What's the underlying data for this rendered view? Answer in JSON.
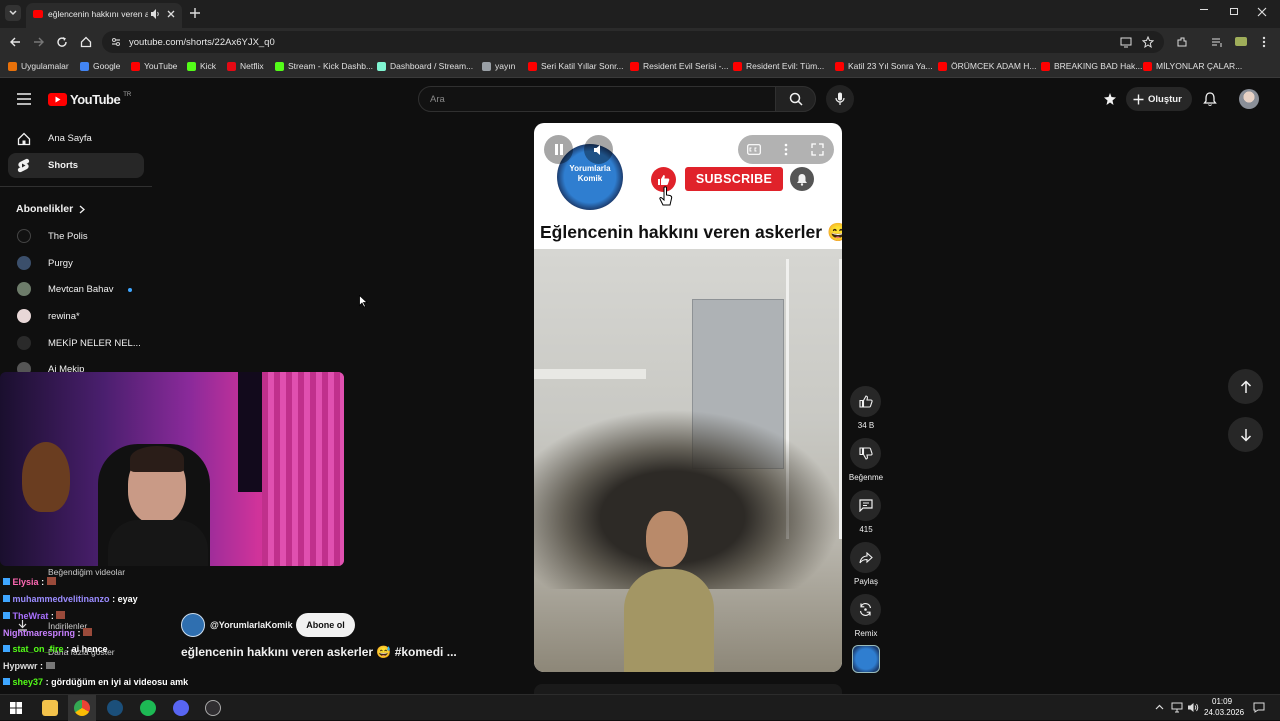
{
  "browser": {
    "tab_title": "eğlencenin hakkını veren askerler",
    "url": "youtube.com/shorts/22Ax6YJX_q0",
    "bookmarks": [
      {
        "label": "Uygulamalar",
        "icon": "apps-grid-icon",
        "color": "#e8710a"
      },
      {
        "label": "Google",
        "icon": "google-icon",
        "color": "#4285f4"
      },
      {
        "label": "YouTube",
        "icon": "youtube-icon",
        "color": "#ff0000"
      },
      {
        "label": "Kick",
        "icon": "kick-icon",
        "color": "#53fc18"
      },
      {
        "label": "Netflix",
        "icon": "netflix-icon",
        "color": "#e50914"
      },
      {
        "label": "Stream - Kick Dashb...",
        "icon": "kick-icon",
        "color": "#53fc18"
      },
      {
        "label": "Dashboard / Stream...",
        "icon": "streamlabs-icon",
        "color": "#80f5d2"
      },
      {
        "label": "yayın",
        "icon": "folder-icon",
        "color": "#9aa0a6"
      },
      {
        "label": "Seri Katil Yıllar Sonr...",
        "icon": "youtube-icon",
        "color": "#ff0000"
      },
      {
        "label": "Resident Evil Serisi -...",
        "icon": "youtube-icon",
        "color": "#ff0000"
      },
      {
        "label": "Resident Evil: Tüm...",
        "icon": "youtube-icon",
        "color": "#ff0000"
      },
      {
        "label": "Katil 23 Yıl Sonra Ya...",
        "icon": "youtube-icon",
        "color": "#ff0000"
      },
      {
        "label": "ÖRÜMCEK ADAM H...",
        "icon": "youtube-icon",
        "color": "#ff0000"
      },
      {
        "label": "BREAKING BAD Hak...",
        "icon": "youtube-icon",
        "color": "#ff0000"
      },
      {
        "label": "MİLYONLAR ÇALAR...",
        "icon": "youtube-icon",
        "color": "#ff0000"
      }
    ]
  },
  "youtube": {
    "logo_text": "YouTube",
    "logo_region": "TR",
    "search_placeholder": "Ara",
    "create_label": "Oluştur",
    "sidebar": {
      "home": "Ana Sayfa",
      "shorts": "Shorts",
      "subscriptions_header": "Abonelikler",
      "subscriptions": [
        "The Polis",
        "Purgy",
        "Mevtcan Bahav",
        "rewina*",
        "MEKİP NELER NEL...",
        "Ai Mekip"
      ],
      "liked": "Beğendiğim videolar",
      "downloads": "İndirilenler",
      "show_more": "Daha fazla göster"
    },
    "short": {
      "overlay_title": "Eğlencenin hakkını veren askerler 😅",
      "subscribe_overlay": "SUBSCRIBE",
      "channel_logo_text": "Yorumlarla Komik",
      "channel": "@YorumlarlaKomik",
      "subscribe_label": "Abone ol",
      "title": "eğlencenin hakkını veren askerler 😅 #komedi ..."
    },
    "actions": {
      "likes": "34 B",
      "dislike": "Beğenme",
      "comments": "415",
      "share": "Paylaş",
      "remix": "Remix"
    }
  },
  "chat": [
    {
      "user": "Elysia",
      "text": "",
      "color": "#ff69b4"
    },
    {
      "user": "muhammedvelitinanzo",
      "text": "eyay",
      "color": "#9b8cff"
    },
    {
      "user": "TheWrat",
      "text": "",
      "color": "#a970ff"
    },
    {
      "user": "Nightmarespring",
      "text": "",
      "color": "#c880ff"
    },
    {
      "user": "stat_on_fire",
      "text": "ai hence",
      "color": "#53fc18"
    },
    {
      "user": "Hypwwr",
      "text": "",
      "color": "#dddddd"
    },
    {
      "user": "shey37",
      "text": "gördüğüm en iyi ai videosu amk",
      "color": "#53fc18"
    }
  ],
  "system": {
    "time": "01:09",
    "date": "24.03.2026"
  }
}
